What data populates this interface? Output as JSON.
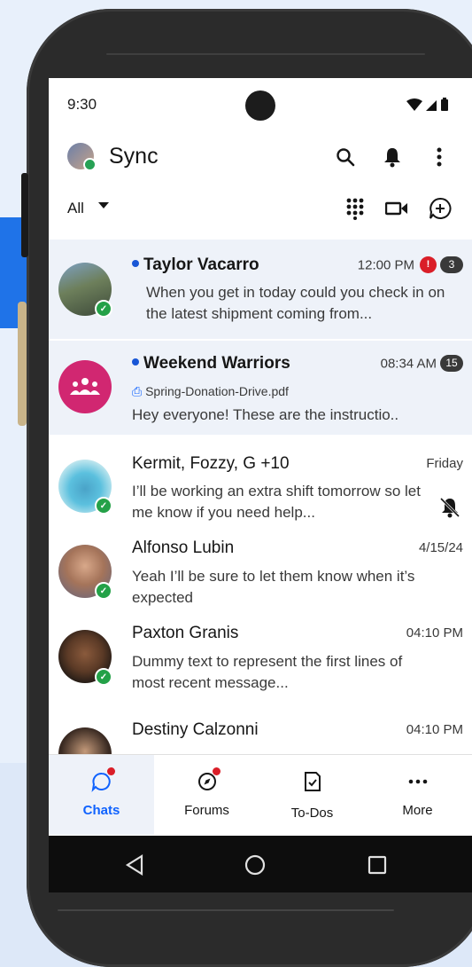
{
  "status_bar": {
    "time": "9:30",
    "system_icons": "▾◢▮"
  },
  "header": {
    "title": "Sync",
    "icons": [
      "search-icon",
      "bell-icon",
      "more-vertical-icon"
    ]
  },
  "filter": {
    "label": "All"
  },
  "chats": [
    {
      "name": "Taylor Vacarro",
      "time": "12:00 PM",
      "unread": true,
      "urgent": "!",
      "count": "3",
      "message": "When you get in today could you check in on the latest shipment coming from..."
    },
    {
      "name": "Weekend Warriors",
      "time": "08:34 AM",
      "unread": true,
      "count": "15",
      "attachment": "Spring-Donation-Drive.pdf",
      "message": "Hey everyone! These are the instructio.."
    },
    {
      "name": "Kermit, Fozzy, G +10",
      "time": "Friday",
      "unread": false,
      "muted": true,
      "message": "I’ll be working an extra shift tomorrow so let me know if you need help..."
    },
    {
      "name": "Alfonso Lubin",
      "time": "4/15/24",
      "unread": false,
      "message": "Yeah I’ll be sure to let them know when it’s expected"
    },
    {
      "name": "Paxton Granis",
      "time": "04:10 PM",
      "unread": false,
      "message": "Dummy text to represent the first lines of most recent message..."
    },
    {
      "name": "Destiny Calzonni",
      "time": "04:10 PM",
      "unread": false,
      "message": ""
    }
  ],
  "bottom_nav": [
    {
      "label": "Chats",
      "active": true
    },
    {
      "label": "Forums",
      "active": false
    },
    {
      "label": "To-Dos",
      "active": false
    },
    {
      "label": "More",
      "active": false
    }
  ],
  "colors": {
    "accent": "#0f62fe",
    "online": "#24a148",
    "alert": "#da1e28",
    "unread_bg": "#eef2f9",
    "group_avatar": "#d12771"
  }
}
